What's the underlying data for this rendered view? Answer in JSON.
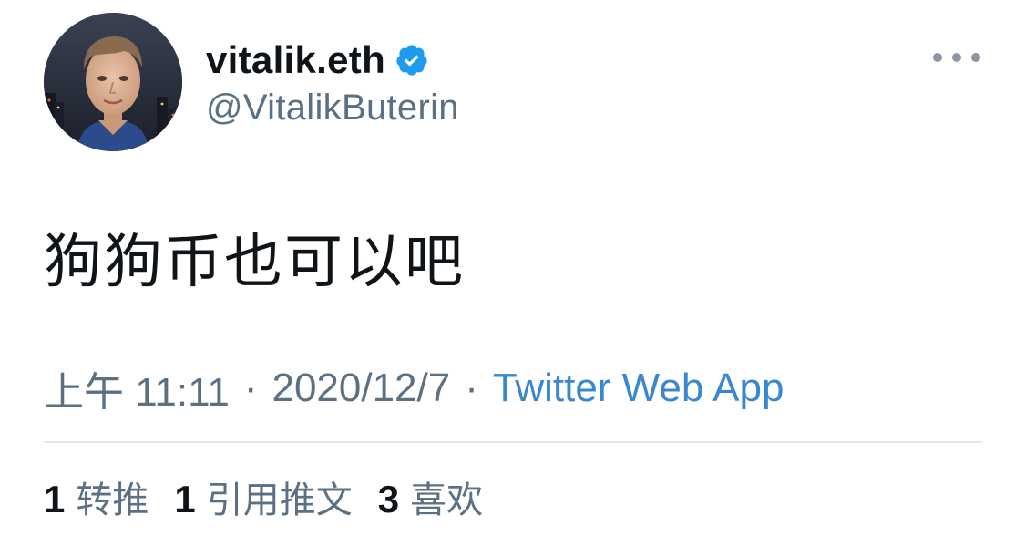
{
  "author": {
    "display_name": "vitalik.eth",
    "handle": "@VitalikButerin",
    "verified": true
  },
  "tweet": {
    "text": "狗狗币也可以吧"
  },
  "meta": {
    "time": "上午 11:11",
    "separator": "·",
    "date": "2020/12/7",
    "source": "Twitter Web App"
  },
  "stats": [
    {
      "count": "1",
      "label": "转推"
    },
    {
      "count": "1",
      "label": "引用推文"
    },
    {
      "count": "3",
      "label": "喜欢"
    }
  ],
  "colors": {
    "verified_badge": "#1d9bf0",
    "source_link": "#3b87cf",
    "secondary_text": "#5b7083",
    "primary_text": "#0f1419"
  },
  "icons": {
    "verified": "verified-badge-icon",
    "more": "more-options-icon"
  }
}
